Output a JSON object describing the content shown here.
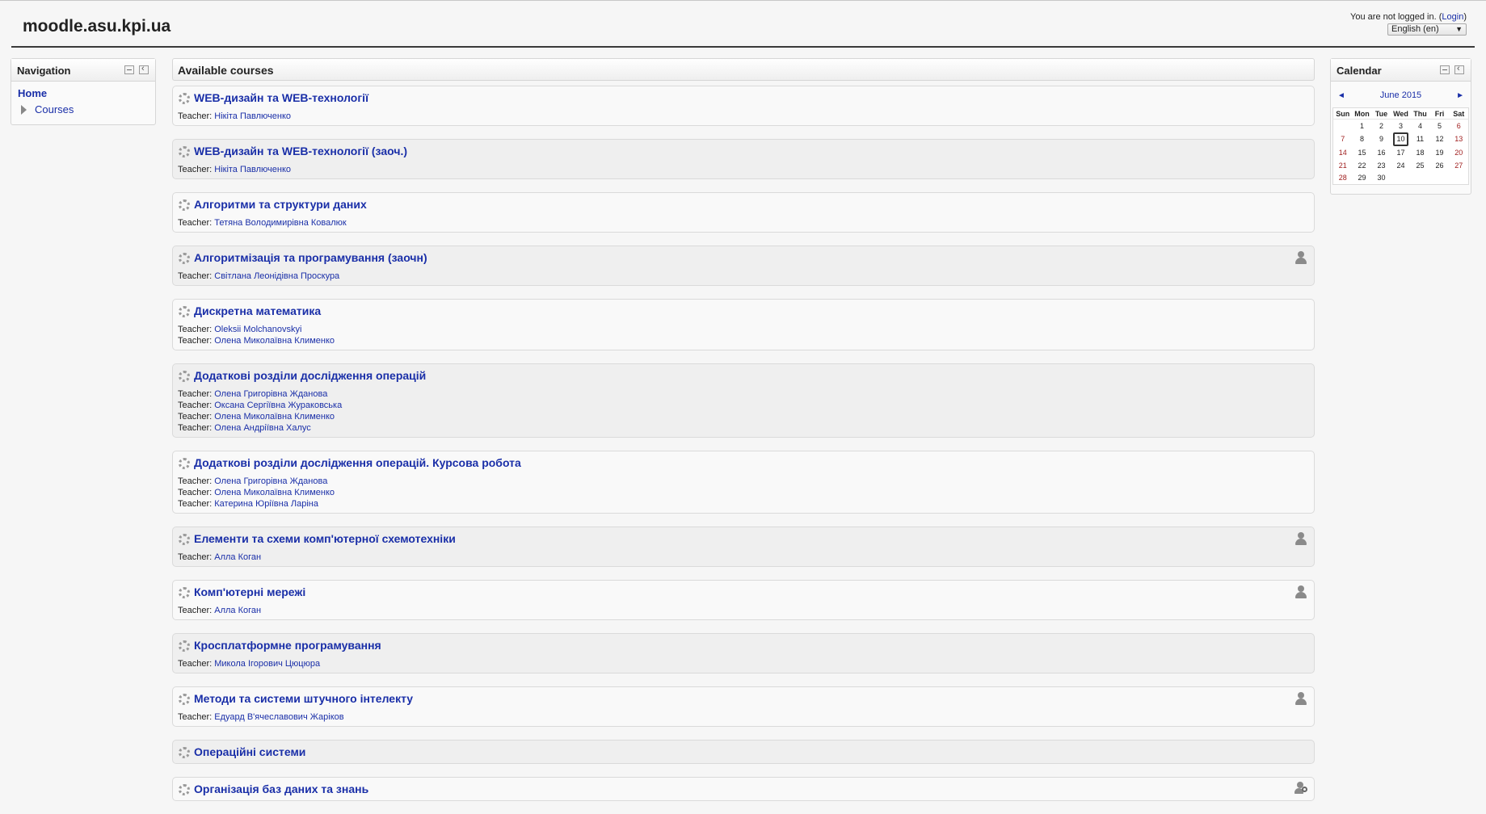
{
  "header": {
    "site_title": "moodle.asu.kpi.ua",
    "login_prefix": "You are not logged in. (",
    "login_link": "Login",
    "login_suffix": ")",
    "language": "English (en)"
  },
  "navigation": {
    "title": "Navigation",
    "home": "Home",
    "courses": "Courses"
  },
  "main": {
    "title": "Available courses",
    "teacher_label": "Teacher: "
  },
  "courses": [
    {
      "name": "WEB-дизайн та WEB-технології",
      "teachers": [
        "Нікіта Павлюченко"
      ],
      "icon": ""
    },
    {
      "name": "WEB-дизайн та WEB-технології (заоч.)",
      "teachers": [
        "Нікіта Павлюченко"
      ],
      "icon": ""
    },
    {
      "name": "Алгоритми та структури даних",
      "teachers": [
        "Тетяна Володимирівна Ковалюк"
      ],
      "icon": ""
    },
    {
      "name": "Алгоритмізація та програмування (заочн)",
      "teachers": [
        "Світлана Леонідівна Проскура"
      ],
      "icon": "guest-access-icon"
    },
    {
      "name": "Дискретна математика",
      "teachers": [
        "Oleksii Molchanovskyi",
        "Олена Миколаївна Клименко"
      ],
      "icon": ""
    },
    {
      "name": "Додаткові розділи дослідження операцій",
      "teachers": [
        "Олена Григорівна Жданова",
        "Оксана Сергіївна Жураковська",
        "Олена Миколаївна Клименко",
        "Олена Андріївна Халус"
      ],
      "icon": ""
    },
    {
      "name": "Додаткові розділи дослідження операцій. Курсова робота",
      "teachers": [
        "Олена Григорівна Жданова",
        "Олена Миколаївна Клименко",
        "Катерина Юріївна Ларіна"
      ],
      "icon": ""
    },
    {
      "name": "Елементи та схеми комп'ютерної схемотехніки",
      "teachers": [
        "Алла Коган"
      ],
      "icon": "guest-access-icon"
    },
    {
      "name": "Комп'ютерні мережі",
      "teachers": [
        "Алла Коган"
      ],
      "icon": "guest-access-icon"
    },
    {
      "name": "Кросплатформне програмування",
      "teachers": [
        "Микола Ігорович Цюцюра"
      ],
      "icon": ""
    },
    {
      "name": "Методи та системи штучного інтелекту",
      "teachers": [
        "Едуард В'ячеславович Жаріков"
      ],
      "icon": "guest-access-icon"
    },
    {
      "name": "Операційні системи",
      "teachers": [],
      "icon": ""
    },
    {
      "name": "Організація баз даних та знань",
      "teachers": [],
      "icon": "enrolment-key-icon"
    }
  ],
  "calendar": {
    "title": "Calendar",
    "prev": "◄",
    "next": "►",
    "month": "June 2015",
    "days": [
      "Sun",
      "Mon",
      "Tue",
      "Wed",
      "Thu",
      "Fri",
      "Sat"
    ],
    "weeks": [
      [
        "",
        "1",
        "2",
        "3",
        "4",
        "5",
        "6"
      ],
      [
        "7",
        "8",
        "9",
        "10",
        "11",
        "12",
        "13"
      ],
      [
        "14",
        "15",
        "16",
        "17",
        "18",
        "19",
        "20"
      ],
      [
        "21",
        "22",
        "23",
        "24",
        "25",
        "26",
        "27"
      ],
      [
        "28",
        "29",
        "30",
        "",
        "",
        "",
        ""
      ]
    ],
    "today": "10"
  }
}
